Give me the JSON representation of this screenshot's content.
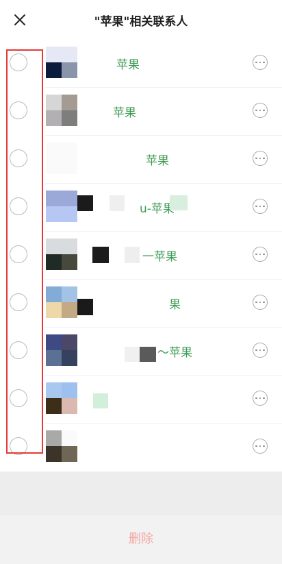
{
  "header": {
    "title": "\"苹果\"相关联系人",
    "close_icon": "close-icon"
  },
  "contacts": [
    {
      "name": "苹果",
      "selected": false
    },
    {
      "name": "苹果",
      "selected": false
    },
    {
      "name": "苹果",
      "selected": false
    },
    {
      "name": "u-苹果",
      "selected": false
    },
    {
      "name": "一苹果",
      "selected": false
    },
    {
      "name": "果",
      "selected": false
    },
    {
      "name": "～苹果",
      "selected": false
    },
    {
      "name": "",
      "selected": false
    },
    {
      "name": "",
      "selected": false
    }
  ],
  "footer": {
    "delete_label": "删除",
    "delete_color": "#f3a7a4"
  },
  "colors": {
    "name_green": "#3c9a53",
    "highlight_red": "#e53935"
  }
}
